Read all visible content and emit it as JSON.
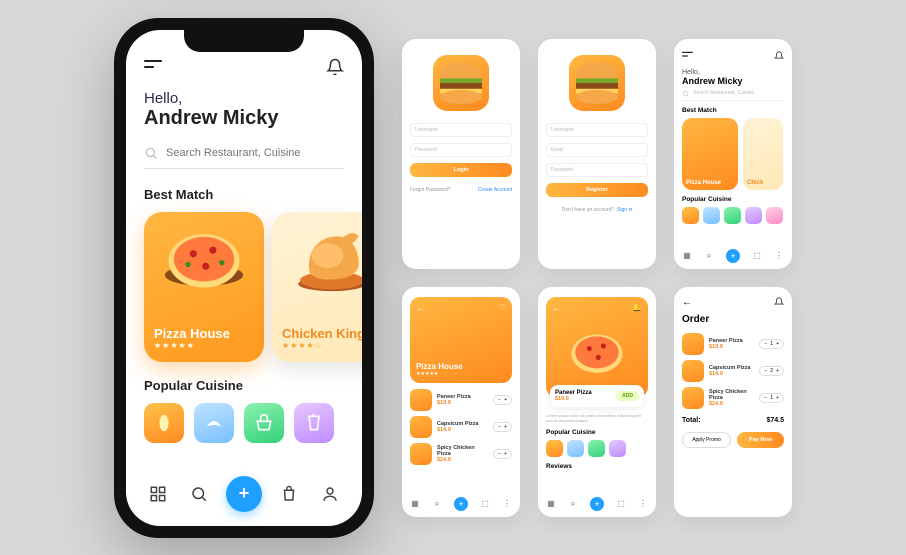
{
  "colors": {
    "accent": "#ff9a1f",
    "blue": "#1f9fff"
  },
  "main": {
    "greeting": "Hello,",
    "username": "Andrew Micky",
    "search_placeholder": "Search Restaurant, Cuisine",
    "best_match_label": "Best Match",
    "cards": [
      {
        "title": "Pizza House",
        "rating_stars": "★★★★★"
      },
      {
        "title": "Chicken King",
        "rating_stars": "★★★★☆"
      }
    ],
    "popular_label": "Popular Cuisine"
  },
  "login": {
    "username_ph": "Username",
    "password_ph": "Password",
    "button": "Login",
    "forgot": "Forgot Password?",
    "create": "Create Account"
  },
  "register": {
    "username_ph": "Username",
    "email_ph": "Email",
    "password_ph": "Password",
    "button": "Register",
    "have_account": "Don't have an account?",
    "signin": "Sign in"
  },
  "home_mini": {
    "greeting": "Hello,",
    "username": "Andrew Micky",
    "search_placeholder": "Search Restaurant, Cuisine",
    "best_match_label": "Best Match",
    "pizza": "Pizza House",
    "chicken": "Chick",
    "popular_label": "Popular Cuisine"
  },
  "restaurant": {
    "title": "Pizza House",
    "stars": "★★★★★",
    "items": [
      {
        "name": "Paneer Pizza",
        "price": "$19.9"
      },
      {
        "name": "Capsicum Pizza",
        "price": "$14.9"
      },
      {
        "name": "Spicy Chicken Pizza",
        "price": "$24.9"
      }
    ]
  },
  "detail": {
    "title": "Paneer Pizza",
    "price": "$19.9",
    "add": "ADD",
    "desc": "Lorem ipsum dolor sit amet consectetur adipiscing elit sed do eiusmod tempor.",
    "popular_label": "Popular Cuisine",
    "reviews_label": "Reviews"
  },
  "order": {
    "title": "Order",
    "items": [
      {
        "name": "Paneer Pizza",
        "price": "$19.9",
        "qty": "1"
      },
      {
        "name": "Capsicum Pizza",
        "price": "$14.9",
        "qty": "2"
      },
      {
        "name": "Spicy Chicken Pizza",
        "price": "$24.9",
        "qty": "1"
      }
    ],
    "total_label": "Total:",
    "total_value": "$74.5",
    "promo": "Apply Promo",
    "pay": "Pay Now"
  }
}
